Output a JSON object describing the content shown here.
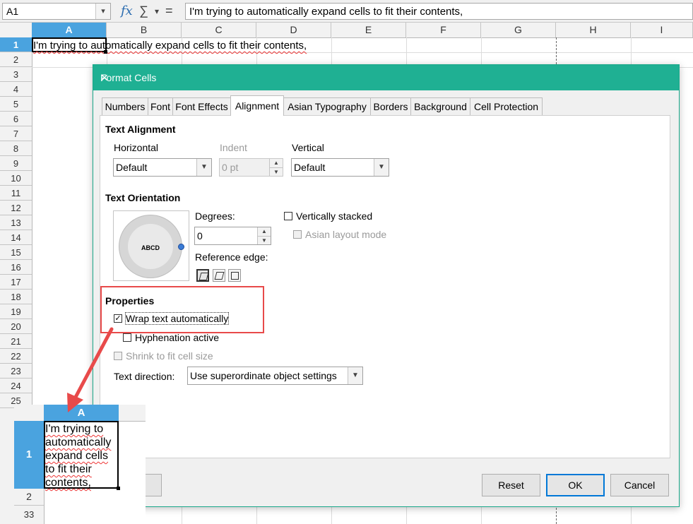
{
  "formula_bar": {
    "name_box": "A1",
    "fx": "fx",
    "sigma": "∑",
    "dropdown": "▾",
    "equals": "=",
    "content": "I'm trying to automatically expand cells to fit their contents,"
  },
  "sheet": {
    "columns": [
      "A",
      "B",
      "C",
      "D",
      "E",
      "F",
      "G",
      "H",
      "I"
    ],
    "rows": [
      "1",
      "2",
      "3",
      "4",
      "5",
      "6",
      "7",
      "8",
      "9",
      "10",
      "11",
      "12",
      "13",
      "14",
      "15",
      "16",
      "17",
      "18",
      "19",
      "20",
      "21",
      "22",
      "23",
      "24",
      "25"
    ],
    "cell_a1": "I'm trying to automatically expand cells to fit their contents,"
  },
  "dialog": {
    "title": "Format Cells",
    "close": "✕",
    "tabs": [
      "Numbers",
      "Font",
      "Font Effects",
      "Alignment",
      "Asian Typography",
      "Borders",
      "Background",
      "Cell Protection"
    ],
    "active_tab": "Alignment",
    "text_alignment": {
      "title": "Text Alignment",
      "horizontal_label": "Horizontal",
      "horizontal_value": "Default",
      "indent_label": "Indent",
      "indent_value": "0 pt",
      "vertical_label": "Vertical",
      "vertical_value": "Default"
    },
    "text_orientation": {
      "title": "Text Orientation",
      "dial_text": "ABCD",
      "degrees_label": "Degrees:",
      "degrees_value": "0",
      "reference_edge_label": "Reference edge:",
      "vertically_stacked": "Vertically stacked",
      "asian_layout_mode": "Asian layout mode"
    },
    "properties": {
      "title": "Properties",
      "wrap_text": "Wrap text automatically",
      "wrap_checked": true,
      "hyphenation": "Hyphenation active",
      "shrink": "Shrink to fit cell size",
      "text_direction_label": "Text direction:",
      "text_direction_value": "Use superordinate object settings"
    },
    "buttons": {
      "reset": "Reset",
      "ok": "OK",
      "cancel": "Cancel"
    }
  },
  "inset": {
    "column": "A",
    "row1": "1",
    "row2": "2",
    "row3": "33",
    "cell_text": "I'm trying to automatically expand cells to fit their contents,"
  },
  "colors": {
    "dialog_title_bar": "#1fb093",
    "selection": "#4aa3df",
    "highlight": "#e84a4a"
  }
}
